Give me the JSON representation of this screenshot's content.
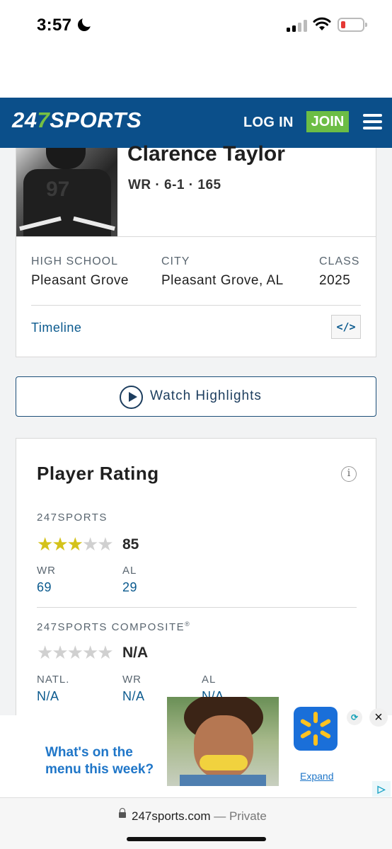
{
  "status_bar": {
    "time": "3:57"
  },
  "header": {
    "logo_prefix": "24",
    "logo_seven": "7",
    "logo_suffix": "SPORTS",
    "login_label": "LOG IN",
    "join_label": "JOIN",
    "brand_color": "#0b4f8a",
    "join_color": "#6cbd45"
  },
  "player": {
    "name": "Clarence Taylor",
    "position": "WR",
    "height": "6-1",
    "weight": "165",
    "meta": "WR · 6-1 · 165",
    "info": [
      {
        "label": "HIGH SCHOOL",
        "value": "Pleasant Grove"
      },
      {
        "label": "CITY",
        "value": "Pleasant Grove, AL"
      },
      {
        "label": "CLASS",
        "value": "2025"
      }
    ],
    "timeline_label": "Timeline",
    "embed_icon": "</>"
  },
  "highlights": {
    "label": "Watch Highlights",
    "icon": "play-circle-icon"
  },
  "rating": {
    "title": "Player Rating",
    "sports247": {
      "label": "247SPORTS",
      "stars_filled": 3,
      "stars_total": 5,
      "score": "85",
      "ranks": [
        {
          "label": "WR",
          "value": "69"
        },
        {
          "label": "AL",
          "value": "29"
        }
      ]
    },
    "composite": {
      "label": "247SPORTS COMPOSITE",
      "registered": "®",
      "stars_filled": 0,
      "stars_total": 5,
      "score": "N/A",
      "ranks": [
        {
          "label": "NATL.",
          "value": "N/A"
        },
        {
          "label": "WR",
          "value": "N/A"
        },
        {
          "label": "AL",
          "value": "N/A"
        }
      ]
    }
  },
  "ad": {
    "headline": "What's on the menu this week?",
    "expand_label": "Expand",
    "close_icon": "close-icon",
    "brand_icon": "walmart-spark-icon"
  },
  "url_bar": {
    "domain": "247sports.com",
    "mode": " — Private"
  }
}
